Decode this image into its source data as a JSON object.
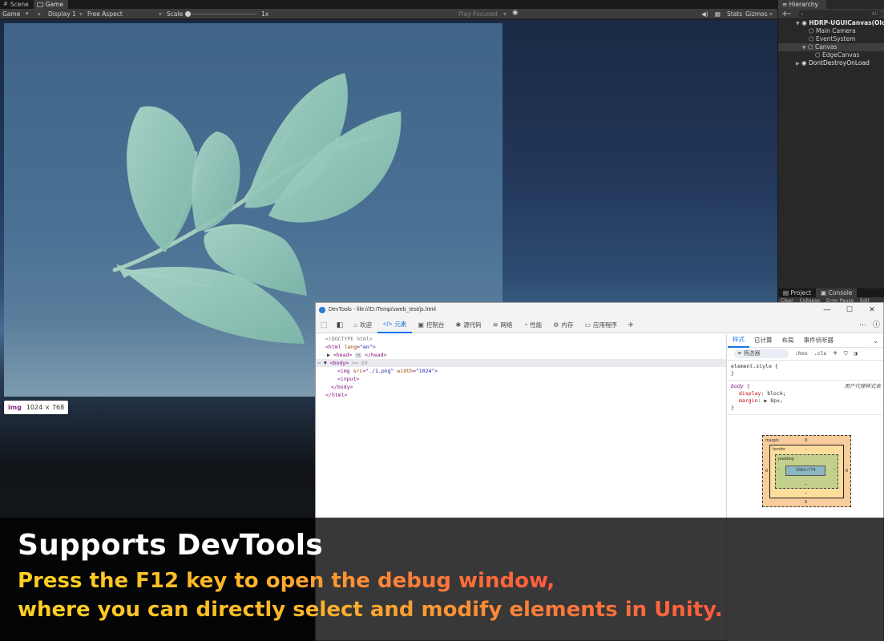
{
  "unity": {
    "tabs": [
      {
        "label": "Scene",
        "icon": "hash-icon"
      },
      {
        "label": "Game",
        "icon": "gamepad-icon"
      }
    ],
    "toolbar": {
      "game_dropdown": "Game",
      "display_dropdown": "Display 1",
      "aspect_dropdown": "Free Aspect",
      "scale_label": "Scale",
      "scale_value": "1x",
      "play_focused": "Play Focused",
      "stats": "Stats",
      "gizmos": "Gizmos"
    },
    "hierarchy": {
      "title": "Hierarchy",
      "add_label": "+",
      "search_placeholder": "All",
      "items": [
        {
          "label": "HDRP-UGUICanvas(Old)",
          "level": 0
        },
        {
          "label": "Main Camera",
          "level": 1
        },
        {
          "label": "EventSystem",
          "level": 1
        },
        {
          "label": "Canvas",
          "level": 1
        },
        {
          "label": "EdgeCanvas",
          "level": 2
        },
        {
          "label": "DontDestroyOnLoad",
          "level": 0
        }
      ]
    },
    "bottom_tabs": {
      "project": "Project",
      "console": "Console",
      "sub_clear": "Clear",
      "sub_collapse": "Collapse",
      "sub_error_pause": "Error Pause",
      "sub_editor": "Edit"
    }
  },
  "img_badge": {
    "tag": "img",
    "size": "1024 × 768"
  },
  "devtools": {
    "title": "DevTools - file:///D:/Temp/uweb_test/js.html",
    "tabs": [
      {
        "label": "欢迎",
        "icon": "⌂"
      },
      {
        "label": "元素",
        "icon": "</>"
      },
      {
        "label": "控制台",
        "icon": "▣"
      },
      {
        "label": "源代码",
        "icon": "✱"
      },
      {
        "label": "网络",
        "icon": "≋"
      },
      {
        "label": "性能",
        "icon": "◔"
      },
      {
        "label": "内存",
        "icon": "⚙"
      },
      {
        "label": "应用程序",
        "icon": "▭"
      }
    ],
    "code": {
      "doctype": "<!DOCTYPE html>",
      "html_open": "<html ",
      "html_attr": "lang",
      "html_val": "\"en\"",
      "head_open": "<head>",
      "head_close": "</head>",
      "body_open": "<body>",
      "body_eq": " == $0",
      "img_open": "<img ",
      "img_src_attr": "src",
      "img_src_val": "\"./1.png\"",
      "img_w_attr": " width",
      "img_w_val": "\"1024\"",
      "img_close": ">",
      "input": "<input>",
      "body_close": "</body>",
      "html_close": "</html>"
    },
    "styles": {
      "tabs": [
        "样式",
        "已计算",
        "布局",
        "事件侦听器"
      ],
      "filter_placeholder": "筛选器",
      "hov": ":hov",
      "cls": ".cls",
      "element_style": "element.style {",
      "close_brace": "}",
      "body_selector": "body {",
      "ua_label": "用户代理样式表",
      "display_prop": "display",
      "display_val": "block;",
      "margin_prop": "margin",
      "margin_val": "8px;"
    },
    "box_model": {
      "margin_label": "margin",
      "margin_value": "8",
      "border_label": "border",
      "border_value": "–",
      "padding_label": "padding",
      "padding_value": "–",
      "content_size": "1581×774"
    }
  },
  "caption": {
    "title": "Supports DevTools",
    "line1": "Press the F12 key to open the debug window,",
    "line2": "where you can directly select and modify elements in Unity."
  }
}
